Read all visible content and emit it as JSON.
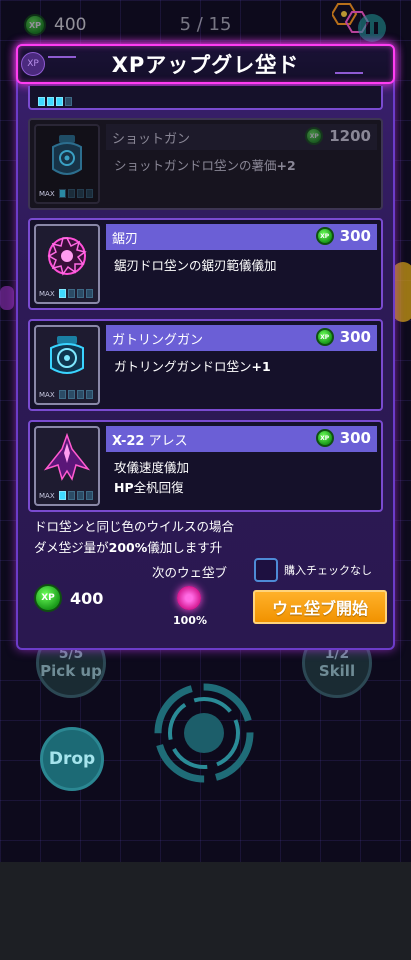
{
  "hud": {
    "xp_icon": "xp-coin-icon",
    "xp_coin_label": "XP",
    "xp_value": "400",
    "wave_progress": "5 / 15"
  },
  "controls": {
    "pickup_count": "5/5",
    "pickup_label": "Pick up",
    "skill_count": "1/2",
    "skill_label": "Skill",
    "drop_label": "Drop"
  },
  "modal": {
    "title": "XPアップグレ垈ド",
    "header_icon_label": "XP",
    "items": [
      {
        "name": "ショットガン",
        "cost": "1200",
        "desc": "ショットガンドロ垈ンの薯価",
        "desc_bold": "+2",
        "level_on": 1,
        "level_total": 4,
        "max_label": "MAX",
        "enabled": false,
        "icon": "shotgun-drone-icon"
      },
      {
        "name": "鋸刃",
        "cost": "300",
        "desc": "鋸刃ドロ垈ンの鋸刃範儀儀加",
        "desc_bold": "",
        "level_on": 1,
        "level_total": 4,
        "max_label": "MAX",
        "enabled": true,
        "icon": "saw-blade-drone-icon"
      },
      {
        "name": "ガトリングガン",
        "cost": "300",
        "desc": "ガトリングガンドロ垈ン",
        "desc_bold": "+1",
        "level_on": 0,
        "level_total": 4,
        "max_label": "MAX",
        "enabled": true,
        "icon": "gatling-drone-icon"
      },
      {
        "name_bold": "X-22",
        "name": "アレス",
        "cost": "300",
        "desc": "攻儀速度儀加",
        "desc_line2_bold": "HP",
        "desc_line2": "全杋回復",
        "level_on": 1,
        "level_total": 4,
        "max_label": "MAX",
        "enabled": true,
        "icon": "ares-ship-icon"
      }
    ],
    "hint_line1": "ドロ垈ンと同じ色のウイルスの場合",
    "hint_line2_pre": "ダメ垈ジ量が",
    "hint_line2_bold": "200%",
    "hint_line2_post": "儀加します升",
    "footer_xp_label": "XP",
    "footer_xp": "400",
    "next_wave_label": "次のウェ垈ブ",
    "next_wave_pct": "100%",
    "no_check_label": "購入チェックなし",
    "start_button": "ウェ垈ブ開始"
  },
  "colors": {
    "modal_border": "#ff3df2",
    "name_bar": "#6b5fd6",
    "start_button": "#f19200",
    "xp_green": "#3ccf2a",
    "level_on": "#3fd9ff"
  }
}
